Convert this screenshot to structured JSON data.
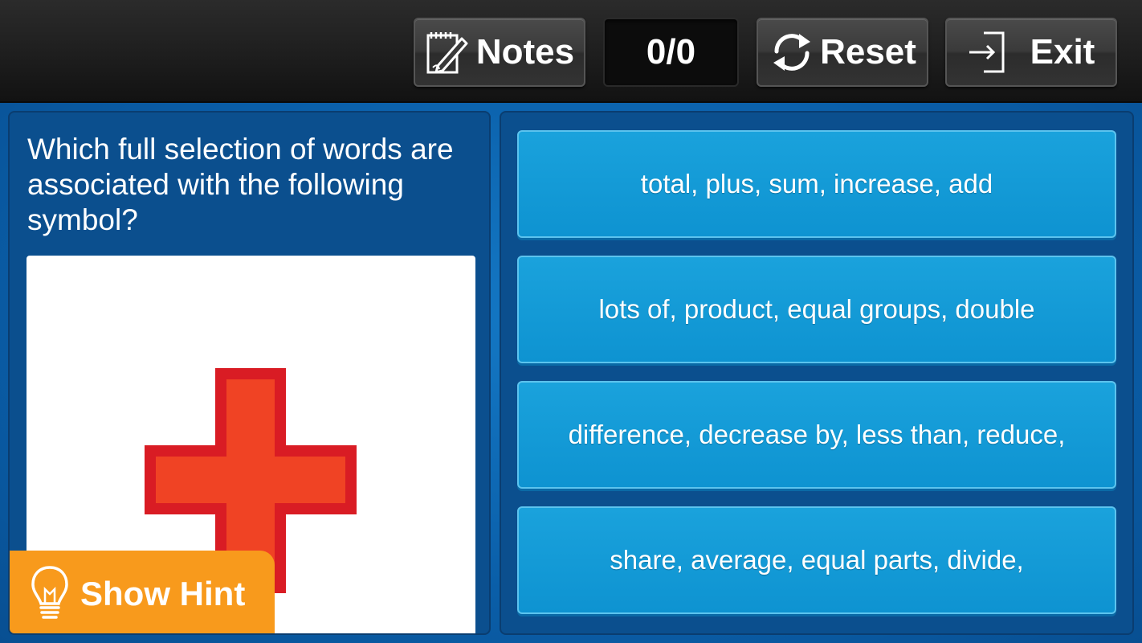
{
  "toolbar": {
    "notes_label": "Notes",
    "score": "0/0",
    "reset_label": "Reset",
    "exit_label": "Exit"
  },
  "question": {
    "text": "Which full selection of words are associated with the following symbol?",
    "symbol_icon": "plus-sign-icon"
  },
  "answers": [
    "total, plus, sum, increase, add",
    "lots of, product, equal groups, double",
    "difference, decrease by, less than, reduce,",
    "share, average, equal parts, divide,"
  ],
  "hint": {
    "label": "Show Hint"
  },
  "colors": {
    "background": "#0b5fa8",
    "answer_button": "#0e93d1",
    "hint_button": "#f89a1c",
    "plus_fill": "#f04324",
    "plus_outline": "#d91c24"
  }
}
